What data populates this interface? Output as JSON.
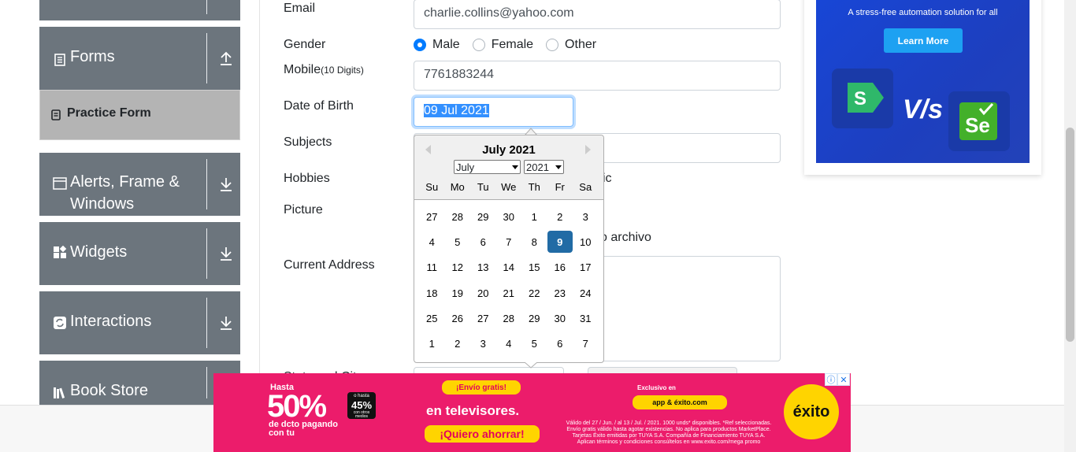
{
  "sidebar": {
    "forms_label": "Forms",
    "practice_form_label": "Practice Form",
    "alerts_label_line1": "Alerts, Frame &",
    "alerts_label_line2": "Windows",
    "widgets_label": "Widgets",
    "interactions_label": "Interactions",
    "book_store_label": "Book Store"
  },
  "form": {
    "email_label": "Email",
    "email_value": "charlie.collins@yahoo.com",
    "gender_label": "Gender",
    "gender_options": [
      "Male",
      "Female",
      "Other"
    ],
    "gender_selected": "Male",
    "mobile_label": "Mobile",
    "mobile_hint": "(10 Digits)",
    "mobile_value": "7761883244",
    "dob_label": "Date of Birth",
    "dob_value": "09 Jul 2021",
    "subjects_label": "Subjects",
    "hobbies_label": "Hobbies",
    "hobbies_fragment": "ic",
    "picture_label": "Picture",
    "picture_fragment": "o archivo",
    "address_label": "Current Address",
    "state_city_label": "State and City"
  },
  "datepicker": {
    "title": "July 2021",
    "month_select": "July",
    "year_select": "2021",
    "weekdays": [
      "Su",
      "Mo",
      "Tu",
      "We",
      "Th",
      "Fr",
      "Sa"
    ],
    "weeks": [
      [
        "27",
        "28",
        "29",
        "30",
        "1",
        "2",
        "3"
      ],
      [
        "4",
        "5",
        "6",
        "7",
        "8",
        "9",
        "10"
      ],
      [
        "11",
        "12",
        "13",
        "14",
        "15",
        "16",
        "17"
      ],
      [
        "18",
        "19",
        "20",
        "21",
        "22",
        "23",
        "24"
      ],
      [
        "25",
        "26",
        "27",
        "28",
        "29",
        "30",
        "31"
      ],
      [
        "1",
        "2",
        "3",
        "4",
        "5",
        "6",
        "7"
      ]
    ],
    "selected_day": "9",
    "selected_color": "#216ba5"
  },
  "right_ad": {
    "tagline": "A stress-free automation solution for all",
    "button": "Learn More",
    "vs": "V/s",
    "logo_left": "S",
    "logo_right": "Se"
  },
  "bottom_ad": {
    "hasta": "Hasta",
    "percent_big": "50%",
    "percent_badge": "45%",
    "badge_line1": "o hasta",
    "badge_line2": "con otros medios",
    "dcto": "de dcto pagando con tu",
    "envio": "¡Envío gratis!",
    "televisores": "en televisores.",
    "cta": "¡Quiero ahorrar!",
    "exclusivo": "Exclusivo en",
    "app_pill": "app & éxito.com",
    "legal": "Válido del 27 / Jun. / al 13 / Jul. / 2021. 1000 unds* disponibles. *Ref seleccionadas. Envío gratis válido hasta agotar existencias. No aplica para productos MarketPlace. Tarjetas Éxito emitidas por TUYA S.A. Compañía de Financiamiento TUYA S.A. Aplican términos y condiciones consúltelos en www.exito.com/mega promo",
    "brand": "éxito",
    "background": "#ec1c6b"
  },
  "colors": {
    "sidebar_group": "#6c757d",
    "active_item": "#b4b4b4",
    "radio_checked": "#007bff"
  }
}
